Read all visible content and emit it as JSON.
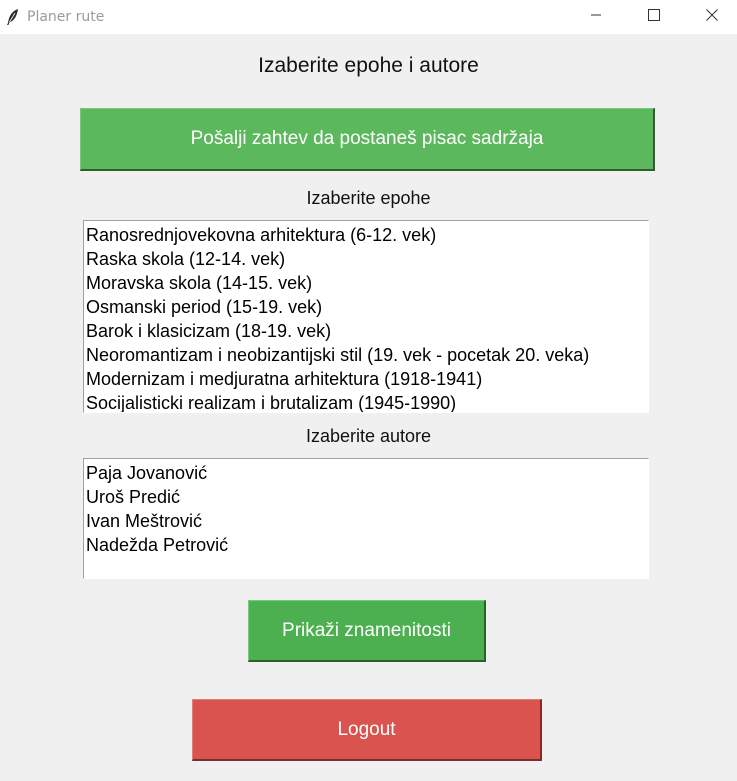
{
  "window": {
    "title": "Planer rute",
    "icon": "feather-icon",
    "controls": [
      "minimize-icon",
      "maximize-icon",
      "close-icon"
    ]
  },
  "heading": "Izaberite epohe i autore",
  "request_button": "Pošalji zahtev da postaneš pisac sadržaja",
  "epochs": {
    "label": "Izaberite epohe",
    "items": [
      "Ranosrednjovekovna arhitektura (6-12. vek)",
      "Raska skola (12-14. vek)",
      "Moravska skola (14-15. vek)",
      "Osmanski period (15-19. vek)",
      "Barok i klasicizam (18-19. vek)",
      "Neoromantizam i neobizantijski stil (19. vek - pocetak 20. veka)",
      "Modernizam i medjuratna arhitektura (1918-1941)",
      "Socijalisticki realizam i brutalizam (1945-1990)"
    ]
  },
  "authors": {
    "label": "Izaberite autore",
    "items": [
      "Paja Jovanović",
      "Uroš Predić",
      "Ivan Meštrović",
      "Nadežda Petrović"
    ]
  },
  "show_button": "Prikaži znamenitosti",
  "logout_button": "Logout",
  "colors": {
    "green_button": "#5cb85c",
    "show_button": "#4caf50",
    "logout_button": "#d9534f",
    "background": "#f0f0f0"
  }
}
